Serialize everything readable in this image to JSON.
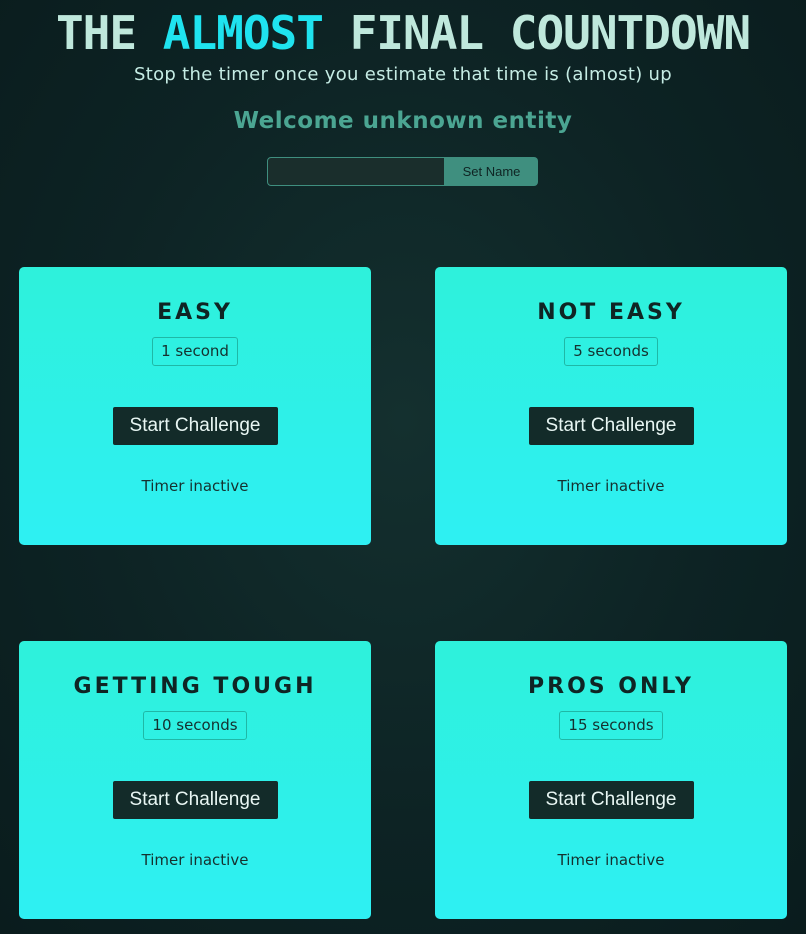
{
  "header": {
    "title_part1": "THE ",
    "title_accent": "ALMOST",
    "title_part2": " FINAL COUNTDOWN",
    "subtitle": "Stop the timer once you estimate that time is (almost) up",
    "welcome": "Welcome unknown entity"
  },
  "name_form": {
    "input_value": "",
    "input_placeholder": "",
    "button_label": "Set Name"
  },
  "challenges": [
    {
      "title": "EASY",
      "duration": "1 second",
      "button_label": "Start Challenge",
      "status": "Timer inactive"
    },
    {
      "title": "NOT EASY",
      "duration": "5 seconds",
      "button_label": "Start Challenge",
      "status": "Timer inactive"
    },
    {
      "title": "GETTING TOUGH",
      "duration": "10 seconds",
      "button_label": "Start Challenge",
      "status": "Timer inactive"
    },
    {
      "title": "PROS ONLY",
      "duration": "15 seconds",
      "button_label": "Start Challenge",
      "status": "Timer inactive"
    }
  ],
  "colors": {
    "background": "#0d2324",
    "title_text": "#bfe8dc",
    "title_accent": "#1fe3ef",
    "welcome_text": "#4ba592",
    "card_gradient_top": "#2ef1db",
    "card_gradient_bottom": "#2ef0f3",
    "button_dark": "#132b29"
  }
}
